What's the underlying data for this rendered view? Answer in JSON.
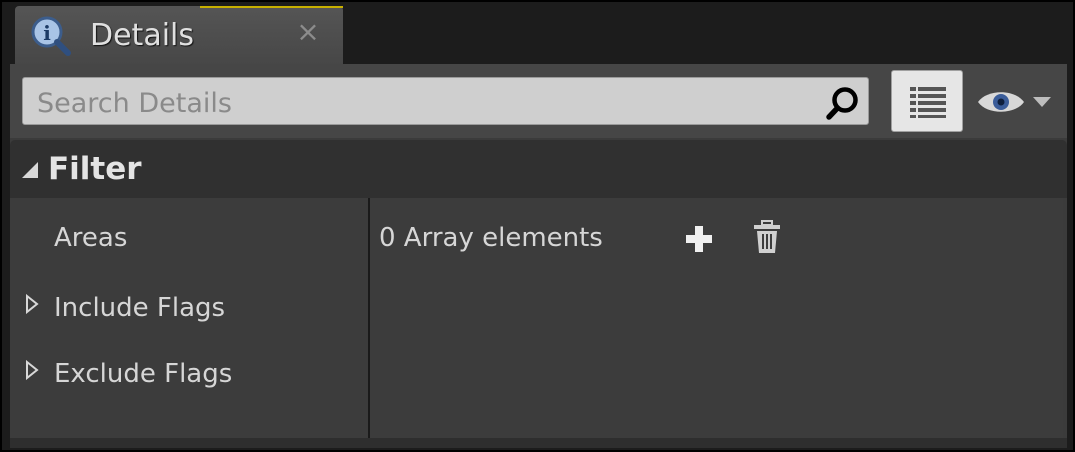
{
  "tab": {
    "label": "Details",
    "close_symbol": "×",
    "icon": "details-magnifier-icon"
  },
  "toolbar": {
    "search_placeholder": "Search Details",
    "search_value": "",
    "search_icon": "search-icon",
    "view_options_icon": "list-view-icon",
    "visibility_icon": "eye-icon"
  },
  "filter": {
    "title": "Filter",
    "rows": [
      {
        "label": "Areas",
        "expandable": false
      },
      {
        "label": "Include Flags",
        "expandable": true
      },
      {
        "label": "Exclude Flags",
        "expandable": true
      }
    ],
    "areas_value": "0 Array elements",
    "add_icon": "plus-icon",
    "delete_icon": "trash-icon"
  },
  "colors": {
    "background": "#1c1c1c",
    "panel": "#3b3b3b",
    "accent": "#c8b000",
    "text": "#d6d6d6"
  }
}
